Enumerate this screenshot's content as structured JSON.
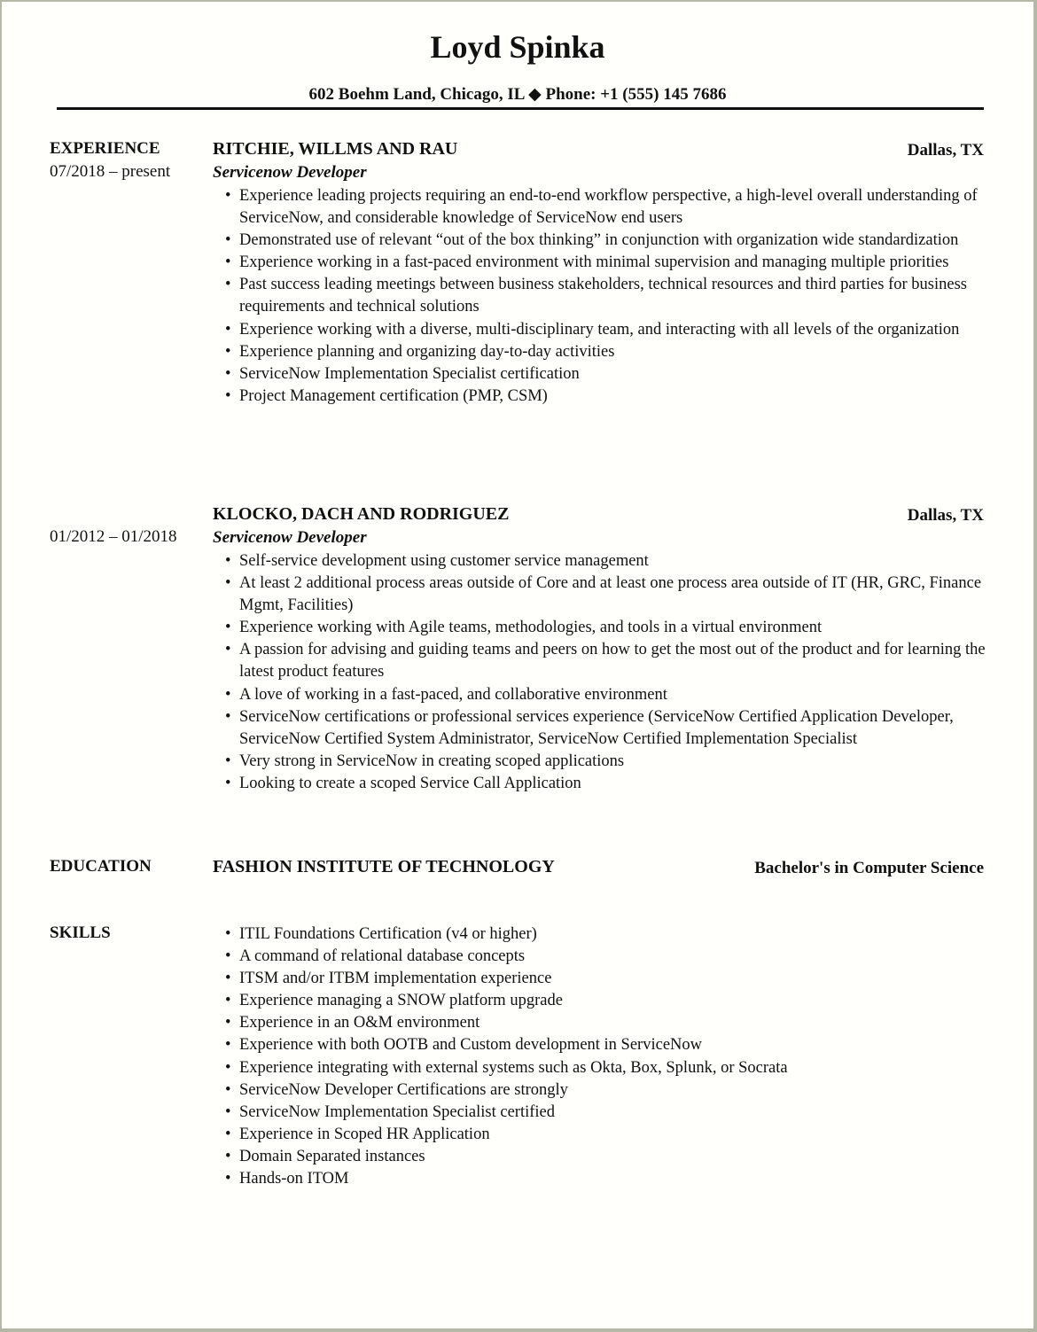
{
  "header": {
    "name": "Loyd Spinka",
    "contact": "602 Boehm Land, Chicago, IL ◆ Phone: +1 (555) 145 7686"
  },
  "experience": {
    "label": "EXPERIENCE",
    "jobs": [
      {
        "dates": "07/2018 – present",
        "company": "RITCHIE, WILLMS AND RAU",
        "location": "Dallas, TX",
        "title": "Servicenow Developer",
        "bullets": [
          "Experience leading projects requiring an end-to-end workflow perspective, a high-level overall understanding of ServiceNow, and considerable knowledge of ServiceNow end users",
          "Demonstrated use of relevant “out of the box thinking” in conjunction with organization wide standardization",
          "Experience working in a fast-paced environment with minimal supervision and managing multiple priorities",
          "Past success leading meetings between business stakeholders, technical resources and third parties for business requirements and technical solutions",
          "Experience working with a diverse, multi-disciplinary team, and interacting with all levels of the organization",
          "Experience planning and organizing day-to-day activities",
          "ServiceNow Implementation Specialist certification",
          "Project Management certification (PMP, CSM)"
        ]
      },
      {
        "dates": "01/2012 – 01/2018",
        "company": "KLOCKO, DACH AND RODRIGUEZ",
        "location": "Dallas, TX",
        "title": "Servicenow Developer",
        "bullets": [
          "Self-service development using customer service management",
          "At least 2 additional process areas outside of Core and at least one process area outside of IT (HR, GRC, Finance Mgmt, Facilities)",
          "Experience working with Agile teams, methodologies, and tools in a virtual environment",
          "A passion for advising and guiding teams and peers on how to get the most out of the product and for learning the latest product features",
          "A love of working in a fast-paced, and collaborative environment",
          "ServiceNow certifications or professional services experience (ServiceNow Certified Application Developer, ServiceNow Certified System Administrator, ServiceNow Certified Implementation Specialist",
          "Very strong in ServiceNow in creating scoped applications",
          "Looking to create a scoped Service Call Application"
        ]
      }
    ]
  },
  "education": {
    "label": "EDUCATION",
    "school": "FASHION INSTITUTE OF TECHNOLOGY",
    "degree": "Bachelor's in Computer Science"
  },
  "skills": {
    "label": "SKILLS",
    "items": [
      "ITIL Foundations Certification (v4 or higher)",
      "A command of relational database concepts",
      "ITSM and/or ITBM implementation experience",
      "Experience managing a SNOW platform upgrade",
      "Experience in an O&M environment",
      "Experience with both OOTB and Custom development in ServiceNow",
      "Experience integrating with external systems such as Okta, Box, Splunk, or Socrata",
      "ServiceNow Developer Certifications are strongly",
      "ServiceNow Implementation Specialist certified",
      "Experience in Scoped HR Application",
      "Domain Separated instances",
      "Hands-on ITOM"
    ]
  }
}
